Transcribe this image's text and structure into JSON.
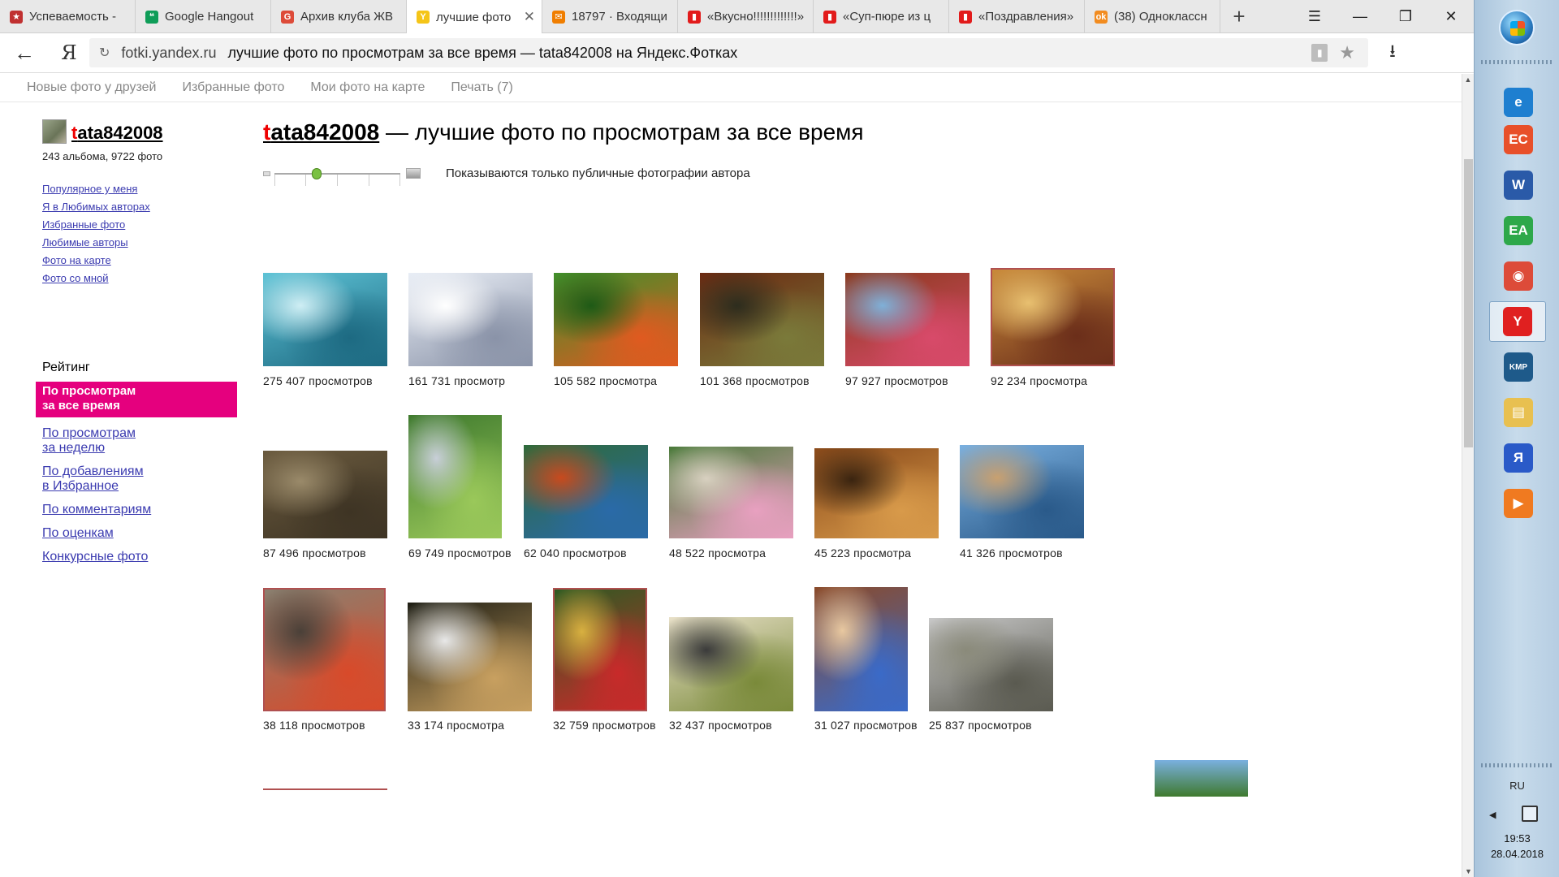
{
  "browser": {
    "tabs": [
      {
        "label": "Успеваемость - ",
        "fav_color": "#c03030",
        "fav_glyph": "★"
      },
      {
        "label": "Google Hangout",
        "fav_color": "#0f9d58",
        "fav_glyph": "❝"
      },
      {
        "label": "Архив клуба ЖВ",
        "fav_color": "#dd4b39",
        "fav_glyph": "G"
      },
      {
        "label": "лучшие фото",
        "fav_color": "#f5c518",
        "fav_glyph": "Y",
        "active": true
      },
      {
        "label": "18797 · Входящи",
        "fav_color": "#f07e00",
        "fav_glyph": "✉"
      },
      {
        "label": "«Вкусно!!!!!!!!!!!!!»",
        "fav_color": "#e21b1b",
        "fav_glyph": "▮"
      },
      {
        "label": "«Суп-пюре из ц",
        "fav_color": "#e21b1b",
        "fav_glyph": "▮"
      },
      {
        "label": "«Поздравления»",
        "fav_color": "#e21b1b",
        "fav_glyph": "▮"
      },
      {
        "label": "(38) Одноклассн",
        "fav_color": "#f28c20",
        "fav_glyph": "ok"
      }
    ],
    "new_tab": "+",
    "menu_glyph": "☰",
    "restore_glyph": "❐",
    "close_glyph": "✕",
    "minimize_glyph": "—",
    "back_glyph": "←",
    "ya_glyph": "Я",
    "reload_glyph": "↻",
    "url_domain": "fotki.yandex.ru",
    "url_title": "лучшие фото по просмотрам за все время — tata842008 на Яндекс.Фотках",
    "star_glyph": "★",
    "download_glyph": "⭳",
    "tab_close_glyph": "✕"
  },
  "topnav": [
    "Новые фото у друзей",
    "Избранные фото",
    "Мои фото на карте",
    "Печать (7)"
  ],
  "sidebar": {
    "username_first": "t",
    "username_rest": "ata842008",
    "stats": "243 альбома, 9722 фото",
    "links": [
      "Популярное у меня",
      "Я в Любимых авторах",
      "Избранные фото",
      "Любимые авторы",
      "Фото на карте",
      "Фото со мной"
    ],
    "rating_title": "Рейтинг",
    "rating_active_line1": "По просмотрам",
    "rating_active_line2": "за все время",
    "rating_links": [
      {
        "l1": "По просмотрам",
        "l2": "за неделю"
      },
      {
        "l1": "По добавлениям",
        "l2": "в Избранное"
      },
      {
        "l1": "По комментариям",
        "l2": ""
      },
      {
        "l1": "По оценкам",
        "l2": ""
      },
      {
        "l1": "Конкурсные фото",
        "l2": ""
      }
    ]
  },
  "main": {
    "title_first": "t",
    "title_user_rest": "ata842008",
    "title_rest": " — лучшие фото по просмотрам за все время",
    "public_note": "Показываются только публичные фотографии автора"
  },
  "photos": [
    {
      "views": "275 407 просмотров",
      "subject": "penguins-underwater",
      "colors": [
        "#5ec3d6",
        "#1d6a82",
        "#cfeef4"
      ]
    },
    {
      "views": "161 731 просмотр",
      "subject": "winter-forest-path",
      "colors": [
        "#e9eef6",
        "#8a93a8",
        "#ffffff"
      ]
    },
    {
      "views": "105 582 просмотра",
      "subject": "red-green-leaves",
      "colors": [
        "#3f8f2a",
        "#e05a20",
        "#1e5a16"
      ]
    },
    {
      "views": "101 368 просмотров",
      "subject": "chestnuts",
      "colors": [
        "#6b2a12",
        "#7a7a3a",
        "#2d2d1e"
      ]
    },
    {
      "views": "97 927 просмотров",
      "subject": "chapel-bridge-lucerne",
      "colors": [
        "#8b3a1e",
        "#d84a6a",
        "#7fb0d8"
      ]
    },
    {
      "views": "92 234 просмотра",
      "subject": "pancake-stack",
      "colors": [
        "#c98a3a",
        "#6b2e1a",
        "#e8c070"
      ],
      "framed": true
    },
    {
      "views": "87 496 просмотров",
      "subject": "frogs-in-pond",
      "colors": [
        "#6a5a3e",
        "#3e3424",
        "#9a8a6a"
      ]
    },
    {
      "views": "69 749 просмотров",
      "subject": "mountain-valley",
      "colors": [
        "#3f7a2e",
        "#9ac85a",
        "#c8cfd8"
      ]
    },
    {
      "views": "62 040 просмотров",
      "subject": "red-sail-boat",
      "colors": [
        "#2e6a3a",
        "#2a6aa8",
        "#c84a1e"
      ]
    },
    {
      "views": "48 522 просмотра",
      "subject": "rose-bush-wall",
      "colors": [
        "#4a7a3a",
        "#e8a0c0",
        "#d8d0c0"
      ]
    },
    {
      "views": "45 223 просмотра",
      "subject": "hen-with-chick",
      "colors": [
        "#8a4a1a",
        "#d89a4a",
        "#3a2410"
      ]
    },
    {
      "views": "41 326 просмотров",
      "subject": "ring-sculpture-sea",
      "colors": [
        "#7ab0e0",
        "#2a5a8a",
        "#c8a070"
      ]
    },
    {
      "views": "38 118 просмотров",
      "subject": "bullfinch-branches",
      "colors": [
        "#8a8070",
        "#d84a2a",
        "#4a4038"
      ],
      "framed": true
    },
    {
      "views": "33 174 просмотра",
      "subject": "arched-street",
      "colors": [
        "#1e1e14",
        "#c8a060",
        "#e8e8e8"
      ]
    },
    {
      "views": "32 759 просмотров",
      "subject": "christmas-tree",
      "colors": [
        "#2e5a22",
        "#c82a2a",
        "#d8b040"
      ],
      "framed": true
    },
    {
      "views": "32 437 просмотров",
      "subject": "salad-dish",
      "colors": [
        "#e8e0c8",
        "#7a8a3a",
        "#3a3a3a"
      ]
    },
    {
      "views": "31 027 просмотров",
      "subject": "slot-canyon",
      "colors": [
        "#8a4a2a",
        "#3a6ac8",
        "#e8c8a0"
      ]
    },
    {
      "views": "25 837 просмотров",
      "subject": "stonehenge",
      "colors": [
        "#c8c8c8",
        "#5a5a50",
        "#8a8a7a"
      ]
    }
  ],
  "taskbar": {
    "icons": [
      {
        "name": "ie-icon",
        "color": "#1e7fd0",
        "glyph": "e"
      },
      {
        "name": "ec-icon",
        "color": "#e8502a",
        "glyph": "EC"
      },
      {
        "name": "word-icon",
        "color": "#2a5aa8",
        "glyph": "W"
      },
      {
        "name": "ea-icon",
        "color": "#2ea84a",
        "glyph": "EA"
      },
      {
        "name": "chrome-icon",
        "color": "#dd4b39",
        "glyph": "◉"
      },
      {
        "name": "yandex-browser-icon",
        "color": "#e02020",
        "glyph": "Y"
      },
      {
        "name": "kmplayer-icon",
        "color": "#1e5a8a",
        "glyph": "KMP"
      },
      {
        "name": "explorer-icon",
        "color": "#e8c050",
        "glyph": "▤"
      },
      {
        "name": "yandex-icon",
        "color": "#2a5ac8",
        "glyph": "Я"
      },
      {
        "name": "media-player-icon",
        "color": "#f07a20",
        "glyph": "▶"
      }
    ],
    "lang": "RU",
    "time": "19:53",
    "date": "28.04.2018"
  }
}
